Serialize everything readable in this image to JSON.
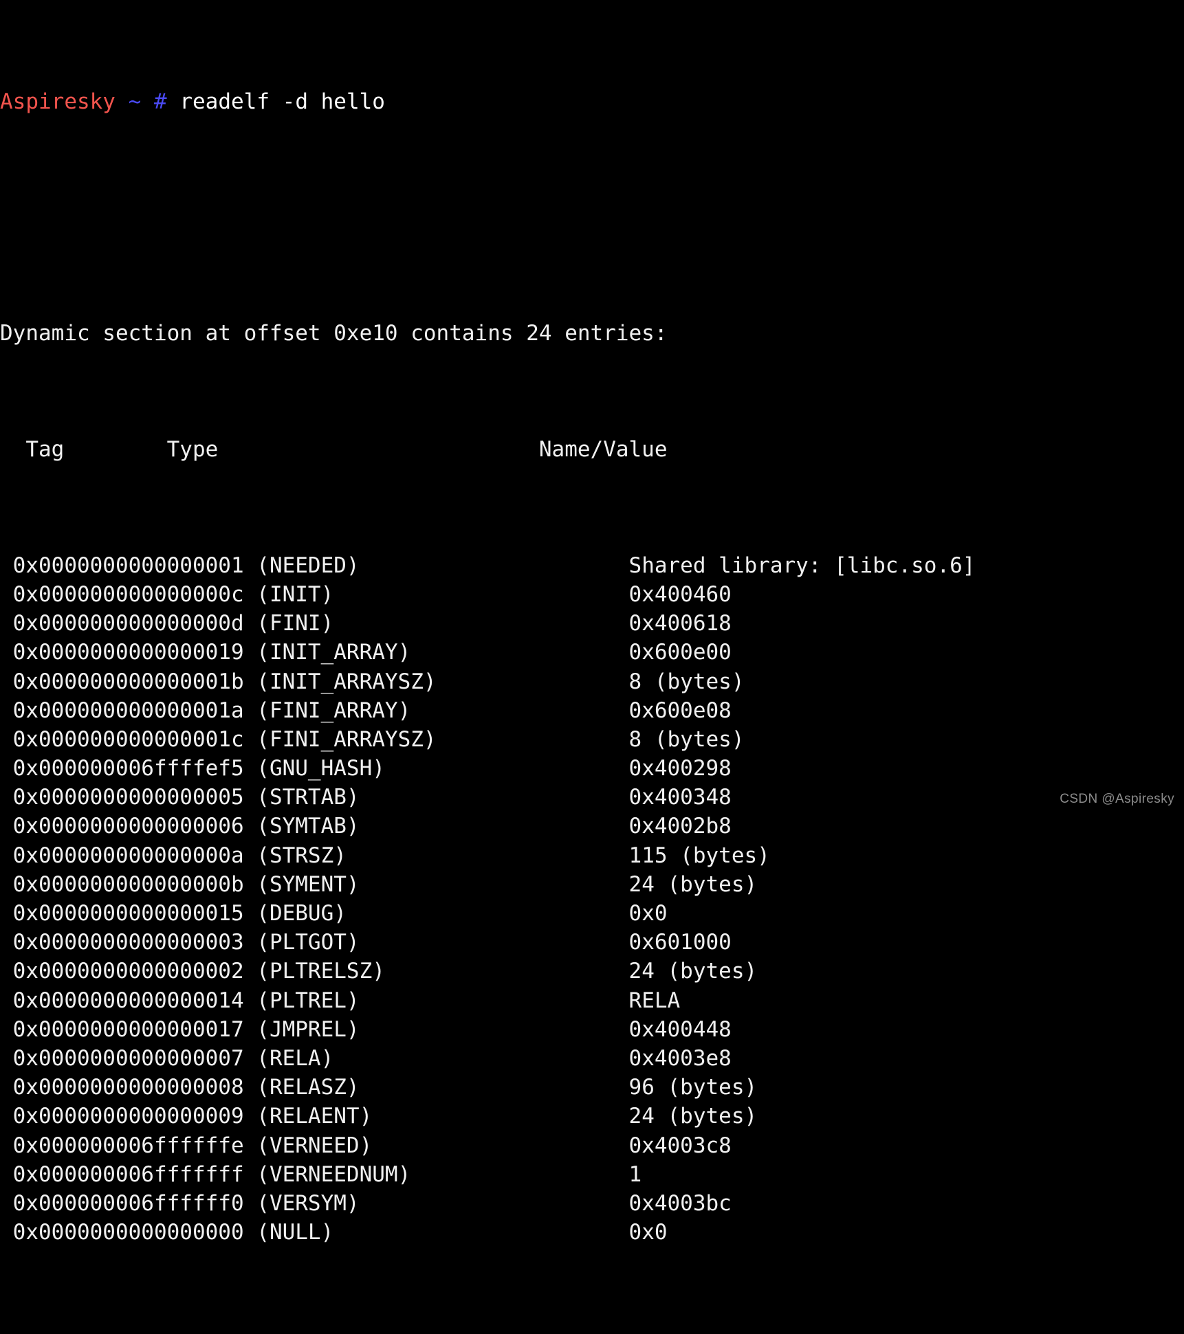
{
  "terminal": {
    "background_color": "#000000",
    "foreground_color": "#f0f0f0",
    "prompt": {
      "host": "Aspiresky",
      "host_color": "#f2544d",
      "path": "~",
      "path_color": "#4a4af5",
      "symbol": "#",
      "symbol_color": "#4a4af5",
      "command": "readelf -d hello"
    },
    "output": {
      "summary": "Dynamic section at offset 0xe10 contains 24 entries:",
      "headers": {
        "tag": "  Tag",
        "type": "Type",
        "name_value": "Name/Value"
      },
      "header_line": "  Tag        Type                         Name/Value",
      "entries": [
        {
          "tag": "0x0000000000000001",
          "type": "(NEEDED)",
          "value": "Shared library: [libc.so.6]"
        },
        {
          "tag": "0x000000000000000c",
          "type": "(INIT)",
          "value": "0x400460"
        },
        {
          "tag": "0x000000000000000d",
          "type": "(FINI)",
          "value": "0x400618"
        },
        {
          "tag": "0x0000000000000019",
          "type": "(INIT_ARRAY)",
          "value": "0x600e00"
        },
        {
          "tag": "0x000000000000001b",
          "type": "(INIT_ARRAYSZ)",
          "value": "8 (bytes)"
        },
        {
          "tag": "0x000000000000001a",
          "type": "(FINI_ARRAY)",
          "value": "0x600e08"
        },
        {
          "tag": "0x000000000000001c",
          "type": "(FINI_ARRAYSZ)",
          "value": "8 (bytes)"
        },
        {
          "tag": "0x000000006ffffef5",
          "type": "(GNU_HASH)",
          "value": "0x400298"
        },
        {
          "tag": "0x0000000000000005",
          "type": "(STRTAB)",
          "value": "0x400348"
        },
        {
          "tag": "0x0000000000000006",
          "type": "(SYMTAB)",
          "value": "0x4002b8"
        },
        {
          "tag": "0x000000000000000a",
          "type": "(STRSZ)",
          "value": "115 (bytes)"
        },
        {
          "tag": "0x000000000000000b",
          "type": "(SYMENT)",
          "value": "24 (bytes)"
        },
        {
          "tag": "0x0000000000000015",
          "type": "(DEBUG)",
          "value": "0x0"
        },
        {
          "tag": "0x0000000000000003",
          "type": "(PLTGOT)",
          "value": "0x601000"
        },
        {
          "tag": "0x0000000000000002",
          "type": "(PLTRELSZ)",
          "value": "24 (bytes)"
        },
        {
          "tag": "0x0000000000000014",
          "type": "(PLTREL)",
          "value": "RELA"
        },
        {
          "tag": "0x0000000000000017",
          "type": "(JMPREL)",
          "value": "0x400448"
        },
        {
          "tag": "0x0000000000000007",
          "type": "(RELA)",
          "value": "0x4003e8"
        },
        {
          "tag": "0x0000000000000008",
          "type": "(RELASZ)",
          "value": "96 (bytes)"
        },
        {
          "tag": "0x0000000000000009",
          "type": "(RELAENT)",
          "value": "24 (bytes)"
        },
        {
          "tag": "0x000000006ffffffe",
          "type": "(VERNEED)",
          "value": "0x4003c8"
        },
        {
          "tag": "0x000000006fffffff",
          "type": "(VERNEEDNUM)",
          "value": "1"
        },
        {
          "tag": "0x000000006ffffff0",
          "type": "(VERSYM)",
          "value": "0x4003bc"
        },
        {
          "tag": "0x0000000000000000",
          "type": "(NULL)",
          "value": "0x0"
        }
      ]
    }
  },
  "watermark": {
    "text": "CSDN @Aspiresky",
    "color": "#8c8c8c"
  }
}
